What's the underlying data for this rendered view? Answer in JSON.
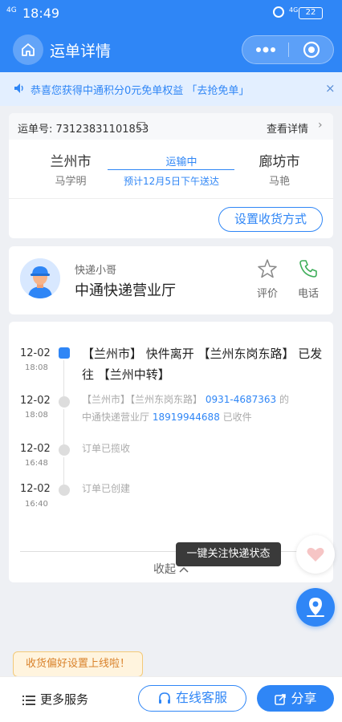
{
  "status_bar": {
    "network": "4G",
    "time": "18:49",
    "net_right": "4G",
    "battery": "22"
  },
  "nav": {
    "title": "运单详情",
    "icons": [
      "home-icon",
      "more-icon",
      "target-icon"
    ]
  },
  "notice": {
    "text": "恭喜您获得中通积分0元免单权益 「去抢免单」",
    "close": "×"
  },
  "waybill": {
    "number_label": "运单号: 73123831101853",
    "detail_link": "查看详情",
    "from_city": "兰州市",
    "from_person": "马学明",
    "status": "运输中",
    "eta": "预计12月5日下午送达",
    "to_city": "廊坊市",
    "to_person": "马艳",
    "setup_button": "设置收货方式"
  },
  "courier": {
    "role": "快递小哥",
    "name": "中通快递营业厅",
    "rate_label": "评价",
    "call_label": "电话"
  },
  "tracking": {
    "events": [
      {
        "date": "12-02",
        "time": "18:08",
        "text": "【兰州市】 快件离开 【兰州东岗东路】 已发往 【兰州中转】"
      },
      {
        "date": "12-02",
        "time": "18:08",
        "text_a": "【兰州市】【兰州东岗东路】",
        "phone_a": "0931-4687363",
        "text_b": "的",
        "text_c": "中通快递营业厅",
        "phone_b": "18919944688",
        "text_d": "已收件"
      },
      {
        "date": "12-02",
        "time": "16:48",
        "text": "订单已揽收"
      },
      {
        "date": "12-02",
        "time": "16:40",
        "text": "订单已创建"
      }
    ],
    "collapse_label": "收起"
  },
  "tooltip": "一键关注快递状态",
  "promo_tip": "收货偏好设置上线啦！",
  "bottom_bar": {
    "more_services": "更多服务",
    "online_service": "在线客服",
    "share": "分享"
  },
  "colors": {
    "brand": "#2f86f6",
    "notice_bg": "#e3efff",
    "tip_orange": "#d9822b"
  }
}
